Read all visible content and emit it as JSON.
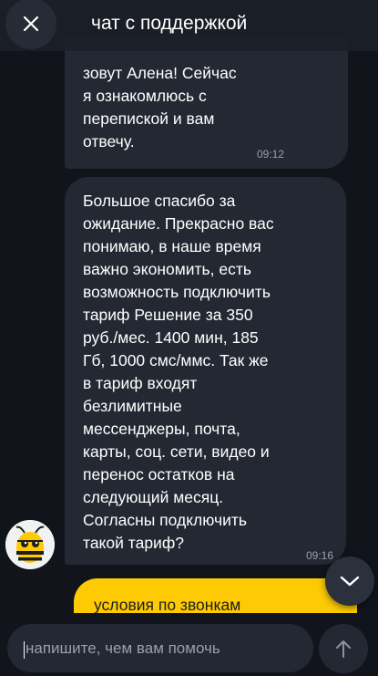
{
  "header": {
    "title": "чат с поддержкой",
    "close_icon": "close-icon"
  },
  "messages": [
    {
      "text": "зовут Алена! Сейчас\nя ознакомлюсь с\nперепиской и вам\nотвечу.",
      "time": "09:12"
    },
    {
      "text": "Большое спасибо за\nожидание. Прекрасно вас\nпонимаю, в наше время\nважно экономить, есть\nвозможность подключить\nтариф Решение за 350\nруб./мес. 1400 мин, 185\nГб, 1000 смс/ммс. Так же\nв тариф входят\nбезлимитные\nмессенджеры, почта,\nкарты, соц. сети, видео и\nперенос остатков на\nследующий месяц.\nСогласны подключить\nтакой тариф?",
      "time": "09:16"
    }
  ],
  "user_message": {
    "text": "условия по звонкам"
  },
  "composer": {
    "placeholder": "напишите, чем вам помочь",
    "send_icon": "arrow-up-icon"
  },
  "colors": {
    "background": "#11141b",
    "bubble": "#232833",
    "accent": "#fdca03"
  }
}
